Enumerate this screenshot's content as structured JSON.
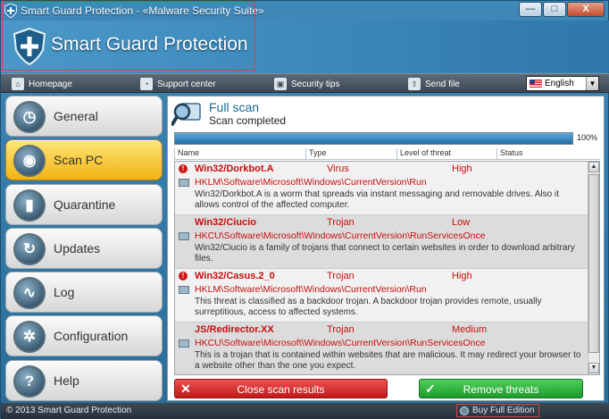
{
  "window": {
    "title": "Smart Guard Protection - «Malware Security Suite»",
    "controls": {
      "minimize": "—",
      "maximize": "□",
      "close": "X"
    }
  },
  "banner": {
    "brand": "Smart Guard Protection"
  },
  "nav": {
    "items": [
      {
        "label": "Homepage",
        "icon": "home-icon"
      },
      {
        "label": "Support center",
        "icon": "rss-icon"
      },
      {
        "label": "Security tips",
        "icon": "lock-icon"
      },
      {
        "label": "Send file",
        "icon": "upload-icon"
      }
    ],
    "language": "English"
  },
  "sidebar": {
    "items": [
      {
        "label": "General",
        "icon": "gauge-icon",
        "active": false
      },
      {
        "label": "Scan PC",
        "icon": "radar-icon",
        "active": true
      },
      {
        "label": "Quarantine",
        "icon": "padlock-icon",
        "active": false
      },
      {
        "label": "Updates",
        "icon": "refresh-icon",
        "active": false
      },
      {
        "label": "Log",
        "icon": "pulse-icon",
        "active": false
      },
      {
        "label": "Configuration",
        "icon": "gear-icon",
        "active": false
      },
      {
        "label": "Help",
        "icon": "question-icon",
        "active": false
      }
    ]
  },
  "scan": {
    "title": "Full scan",
    "status": "Scan completed",
    "progress": 100,
    "progress_label": "100%"
  },
  "table": {
    "columns": [
      "Name",
      "Type",
      "Level of threat",
      "Status"
    ],
    "rows": [
      {
        "name": "Win32/Dorkbot.A",
        "type": "Virus",
        "level": "High",
        "alert": true,
        "path": "HKLM\\Software\\Microsoft\\Windows\\CurrentVersion\\Run",
        "desc": "Win32/Dorkbot.A is a worm that spreads via instant messaging and removable drives. Also it allows control of the affected computer."
      },
      {
        "name": "Win32/Ciucio",
        "type": "Trojan",
        "level": "Low",
        "alert": false,
        "path": "HKCU\\Software\\Microsoft\\Windows\\CurrentVersion\\RunServicesOnce",
        "desc": "Win32/Ciucio is a family of trojans that connect to certain websites in order to download arbitrary files."
      },
      {
        "name": "Win32/Casus.2_0",
        "type": "Trojan",
        "level": "High",
        "alert": true,
        "path": "HKLM\\Software\\Microsoft\\Windows\\CurrentVersion\\Run",
        "desc": "This threat is classified as a backdoor trojan. A backdoor trojan provides remote, usually surreptitious, access to affected systems."
      },
      {
        "name": "JS/Redirector.XX",
        "type": "Trojan",
        "level": "Medium",
        "alert": false,
        "path": "HKCU\\Software\\Microsoft\\Windows\\CurrentVersion\\RunServicesOnce",
        "desc": "This is a trojan that is contained within websites that are malicious. It may redirect your browser to a website other than the one you expect."
      }
    ]
  },
  "actions": {
    "close_label": "Close scan results",
    "remove_label": "Remove threats"
  },
  "statusbar": {
    "copyright": "© 2013 Smart Guard Protection",
    "buy_label": "Buy Full Edition"
  },
  "colors": {
    "accent": "#2f77a8",
    "threat": "#c50f0f",
    "active_tab": "#f3b310",
    "danger": "#c01818",
    "ok": "#1e9a2a"
  }
}
